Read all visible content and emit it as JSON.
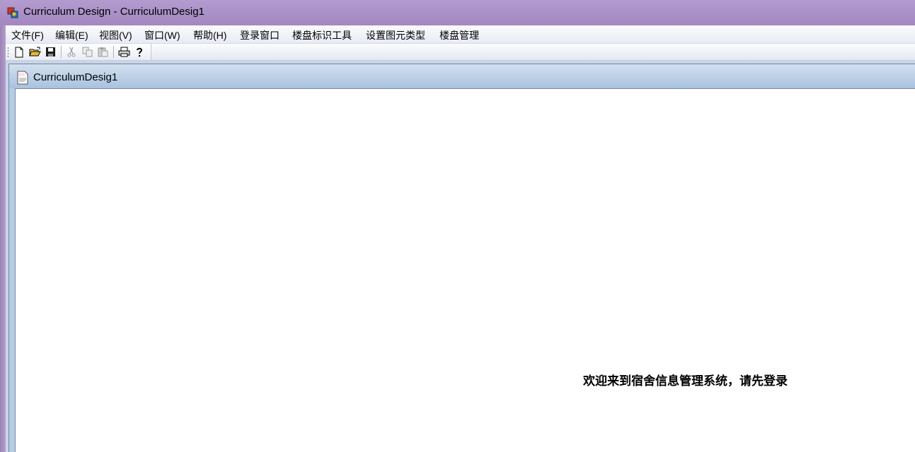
{
  "window": {
    "title": "Curriculum Design - CurriculumDesig1",
    "title_bar_color": "#a58bc0",
    "app_icon": "app-icon"
  },
  "menubar": {
    "items": [
      {
        "label": "文件(F)"
      },
      {
        "label": "编辑(E)"
      },
      {
        "label": "视图(V)"
      },
      {
        "label": "窗口(W)"
      },
      {
        "label": "帮助(H)"
      },
      {
        "label": "登录窗口"
      },
      {
        "label": "楼盘标识工具"
      },
      {
        "label": "设置图元类型"
      },
      {
        "label": "楼盘管理"
      }
    ]
  },
  "toolbar": {
    "buttons": [
      {
        "icon": "new-document-icon",
        "enabled": true
      },
      {
        "icon": "open-folder-icon",
        "enabled": true
      },
      {
        "icon": "save-icon",
        "enabled": true
      },
      {
        "icon": "cut-icon",
        "enabled": false
      },
      {
        "icon": "copy-icon",
        "enabled": false
      },
      {
        "icon": "paste-icon",
        "enabled": false
      },
      {
        "icon": "print-icon",
        "enabled": true
      },
      {
        "icon": "help-icon",
        "enabled": true
      }
    ]
  },
  "document": {
    "title": "CurriculumDesig1",
    "icon": "document-icon",
    "welcome_text": "欢迎来到宿舍信息管理系统，请先登录"
  }
}
